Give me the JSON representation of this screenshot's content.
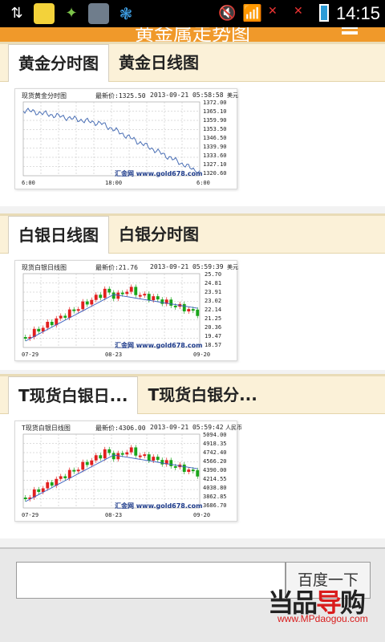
{
  "statusbar": {
    "time": "14:15"
  },
  "header": {
    "title": "黄金属走势图"
  },
  "sections": [
    {
      "tabs": [
        "黄金分时图",
        "黄金日线图"
      ],
      "chart": {
        "title": "现货黄金分时图",
        "price": "最新价:1325.50",
        "date": "2013-09-21 05:58:58",
        "unit": "美元",
        "yticks": [
          "1372.00",
          "1365.10",
          "1359.90",
          "1353.50",
          "1346.50",
          "1339.90",
          "1333.60",
          "1327.10",
          "1320.60"
        ],
        "xticks": [
          "6:00",
          "18:00",
          "6:00"
        ],
        "brand": "汇金网 www.gold678.com"
      }
    },
    {
      "tabs": [
        "白银日线图",
        "白银分时图"
      ],
      "chart": {
        "title": "现货白银日线图",
        "price": "最新价:21.76",
        "date": "2013-09-21 05:59:39",
        "unit": "美元",
        "yticks": [
          "25.70",
          "24.81",
          "23.91",
          "23.02",
          "22.14",
          "21.25",
          "20.36",
          "19.47",
          "18.57"
        ],
        "xticks": [
          "07-29",
          "08-23",
          "09-20"
        ],
        "brand": "汇金网 www.gold678.com"
      }
    },
    {
      "tabs": [
        "T现货白银日...",
        "T现货白银分..."
      ],
      "chart": {
        "title": "T现货白银日线图",
        "price": "最新价:4306.00",
        "date": "2013-09-21 05:59:42",
        "unit": "人民币",
        "yticks": [
          "5094.00",
          "4918.35",
          "4742.40",
          "4566.20",
          "4390.00",
          "4214.55",
          "4038.80",
          "3862.85",
          "3686.70"
        ],
        "xticks": [
          "07-29",
          "08-23",
          "09-20"
        ],
        "brand": "汇金网 www.gold678.com"
      }
    }
  ],
  "search": {
    "value": "",
    "button": "百度一下"
  },
  "watermark": {
    "text_a": "当品",
    "text_b": "导",
    "text_c": "购",
    "url": "www.MPdaogou.com"
  },
  "colors": {
    "accent": "#f0992a",
    "tabbar": "#fbf1d8",
    "price_line": "#4a6fb5",
    "up": "#e21f1f",
    "down": "#1aa51a"
  }
}
